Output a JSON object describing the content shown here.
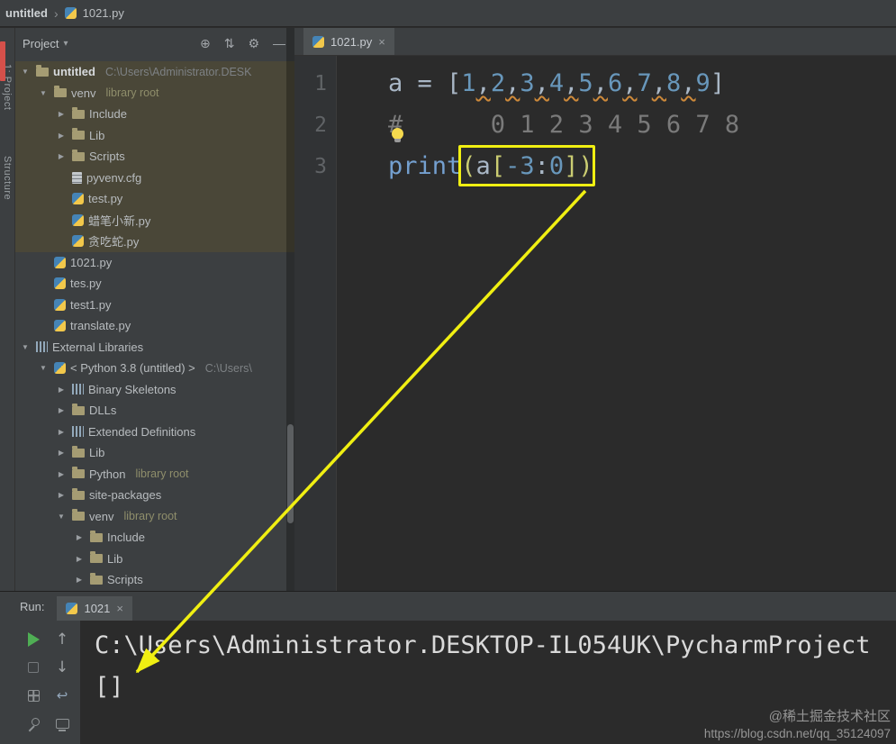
{
  "colors": {
    "panel_bg": "#3c3f41",
    "editor_bg": "#2b2b2b",
    "highlight_row_bg": "#4a4738",
    "annotation_yellow": "#f0ef12",
    "number_blue": "#6897bb",
    "run_green": "#4fae54"
  },
  "icons": {
    "chevron_expanded": "▼",
    "chevron_collapsed": "▶",
    "breadcrumb_separator": "›",
    "dropdown_caret": "▾",
    "close": "×",
    "locate": "⊕",
    "collapse_all": "⇅",
    "settings": "⚙",
    "hide": "—",
    "arrow_up": "↑",
    "arrow_down": "↓",
    "soft_wrap": "↩"
  },
  "title_bar": {
    "breadcrumb": [
      "untitled",
      "1021.py"
    ]
  },
  "left_stripe": {
    "labels": [
      "1: Project",
      "Structure"
    ]
  },
  "project_panel": {
    "title": "Project",
    "tree": [
      {
        "level": 0,
        "expand": "v",
        "icon": "folder",
        "label": "untitled",
        "bold": true,
        "suffix": "C:\\Users\\Administrator.DESK",
        "suffix_style": "path",
        "highlighted": true
      },
      {
        "level": 1,
        "expand": "v",
        "icon": "folder",
        "label": "venv",
        "suffix": "library root",
        "suffix_style": "lib",
        "highlighted": true
      },
      {
        "level": 2,
        "expand": "c",
        "icon": "folder",
        "label": "Include",
        "highlighted": true
      },
      {
        "level": 2,
        "expand": "c",
        "icon": "folder",
        "label": "Lib",
        "highlighted": true
      },
      {
        "level": 2,
        "expand": "c",
        "icon": "folder",
        "label": "Scripts",
        "highlighted": true
      },
      {
        "level": 2,
        "icon": "file",
        "label": "pyvenv.cfg",
        "highlighted": true
      },
      {
        "level": 2,
        "icon": "python",
        "label": "test.py",
        "highlighted": true
      },
      {
        "level": 2,
        "icon": "python",
        "label": "蜡笔小新.py",
        "highlighted": true
      },
      {
        "level": 2,
        "icon": "python",
        "label": "贪吃蛇.py",
        "highlighted": true
      },
      {
        "level": 1,
        "icon": "python",
        "label": "1021.py"
      },
      {
        "level": 1,
        "icon": "python",
        "label": "tes.py"
      },
      {
        "level": 1,
        "icon": "python",
        "label": "test1.py"
      },
      {
        "level": 1,
        "icon": "python",
        "label": "translate.py"
      },
      {
        "level": 0,
        "expand": "v",
        "icon": "lib",
        "label": "External Libraries"
      },
      {
        "level": 1,
        "expand": "v",
        "icon": "python",
        "label": "< Python 3.8 (untitled) >",
        "suffix": "C:\\Users\\",
        "suffix_style": "path"
      },
      {
        "level": 2,
        "expand": "c",
        "icon": "lib",
        "label": "Binary Skeletons"
      },
      {
        "level": 2,
        "expand": "c",
        "icon": "folder",
        "label": "DLLs"
      },
      {
        "level": 2,
        "expand": "c",
        "icon": "lib",
        "label": "Extended Definitions"
      },
      {
        "level": 2,
        "expand": "c",
        "icon": "folder",
        "label": "Lib"
      },
      {
        "level": 2,
        "expand": "c",
        "icon": "folder",
        "label": "Python",
        "suffix": "library root",
        "suffix_style": "lib"
      },
      {
        "level": 2,
        "expand": "c",
        "icon": "folder",
        "label": "site-packages"
      },
      {
        "level": 2,
        "expand": "v",
        "icon": "folder",
        "label": "venv",
        "suffix": "library root",
        "suffix_style": "lib"
      },
      {
        "level": 3,
        "expand": "c",
        "icon": "folder",
        "label": "Include"
      },
      {
        "level": 3,
        "expand": "c",
        "icon": "folder",
        "label": "Lib"
      },
      {
        "level": 3,
        "expand": "c",
        "icon": "folder",
        "label": "Scripts"
      }
    ]
  },
  "editor": {
    "tab": {
      "label": "1021.py"
    },
    "lines": [
      {
        "number": "1",
        "segments": [
          [
            "a",
            "v"
          ],
          [
            " = [",
            "p"
          ],
          [
            "1",
            "n"
          ],
          [
            ",",
            "c"
          ],
          [
            "2",
            "n"
          ],
          [
            ",",
            "c"
          ],
          [
            "3",
            "n"
          ],
          [
            ",",
            "c"
          ],
          [
            "4",
            "n"
          ],
          [
            ",",
            "c"
          ],
          [
            "5",
            "n"
          ],
          [
            ",",
            "c"
          ],
          [
            "6",
            "n"
          ],
          [
            ",",
            "c"
          ],
          [
            "7",
            "n"
          ],
          [
            ",",
            "c"
          ],
          [
            "8",
            "n"
          ],
          [
            ",",
            "c"
          ],
          [
            "9",
            "n"
          ],
          [
            "]",
            "p"
          ]
        ]
      },
      {
        "number": "2",
        "segments": [
          [
            "#      0 1 2 3 4 5 6 7 8",
            "m"
          ]
        ]
      },
      {
        "number": "3",
        "segments": [
          [
            "print",
            "b"
          ],
          [
            "(",
            "y"
          ],
          [
            "a",
            "v"
          ],
          [
            "[",
            "y"
          ],
          [
            "-3",
            "n"
          ],
          [
            ":",
            "p"
          ],
          [
            "0",
            "n"
          ],
          [
            "]",
            "y"
          ],
          [
            ")",
            "y"
          ]
        ]
      }
    ]
  },
  "run_panel": {
    "label": "Run:",
    "tab": "1021",
    "console": [
      "C:\\Users\\Administrator.DESKTOP-IL054UK\\PycharmProject",
      "[]"
    ]
  },
  "watermark": {
    "line1": "@稀土掘金技术社区",
    "line2": "https://blog.csdn.net/qq_35124097"
  }
}
